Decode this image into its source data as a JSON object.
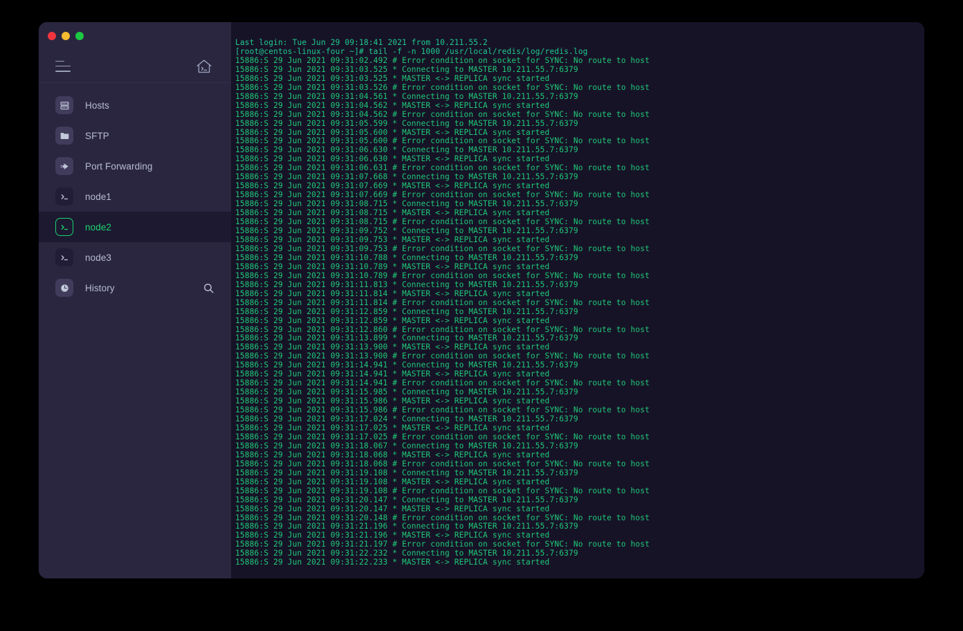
{
  "window": {
    "traffic_lights": [
      {
        "name": "close",
        "color": "#f0353f"
      },
      {
        "name": "minimize",
        "color": "#f6bb2f"
      },
      {
        "name": "maximize",
        "color": "#1dc942"
      }
    ]
  },
  "sidebar": {
    "toolbar": {
      "menu_icon": "hamburger-menu-icon",
      "home_icon": "home-terminal-icon"
    },
    "items": [
      {
        "label": "Hosts",
        "icon": "server-rack-icon",
        "kind": "app",
        "selected": false,
        "trailing": ""
      },
      {
        "label": "SFTP",
        "icon": "folder-icon",
        "kind": "app",
        "selected": false,
        "trailing": ""
      },
      {
        "label": "Port Forwarding",
        "icon": "forward-arrow-icon",
        "kind": "app",
        "selected": false,
        "trailing": ""
      },
      {
        "label": "node1",
        "icon": "terminal-icon",
        "kind": "terminal",
        "selected": false,
        "trailing": ""
      },
      {
        "label": "node2",
        "icon": "terminal-icon",
        "kind": "terminal",
        "selected": true,
        "trailing": ""
      },
      {
        "label": "node3",
        "icon": "terminal-icon",
        "kind": "terminal",
        "selected": false,
        "trailing": ""
      },
      {
        "label": "History",
        "icon": "clock-icon",
        "kind": "app",
        "selected": false,
        "trailing": "search-icon"
      }
    ],
    "colors": {
      "background": "#2a2640",
      "selected_background": "#1d1930",
      "accent_green": "#19d66f",
      "label": "#b9bdd2"
    }
  },
  "terminal": {
    "colors": {
      "background": "#171327",
      "text_green": "#1fc978"
    },
    "lines": [
      "Last login: Tue Jun 29 09:18:41 2021 from 10.211.55.2",
      "[root@centos-linux-four ~]# tail -f -n 1000 /usr/local/redis/log/redis.log",
      "15886:S 29 Jun 2021 09:31:02.492 # Error condition on socket for SYNC: No route to host",
      "15886:S 29 Jun 2021 09:31:03.525 * Connecting to MASTER 10.211.55.7:6379",
      "15886:S 29 Jun 2021 09:31:03.525 * MASTER <-> REPLICA sync started",
      "15886:S 29 Jun 2021 09:31:03.526 # Error condition on socket for SYNC: No route to host",
      "15886:S 29 Jun 2021 09:31:04.561 * Connecting to MASTER 10.211.55.7:6379",
      "15886:S 29 Jun 2021 09:31:04.562 * MASTER <-> REPLICA sync started",
      "15886:S 29 Jun 2021 09:31:04.562 # Error condition on socket for SYNC: No route to host",
      "15886:S 29 Jun 2021 09:31:05.599 * Connecting to MASTER 10.211.55.7:6379",
      "15886:S 29 Jun 2021 09:31:05.600 * MASTER <-> REPLICA sync started",
      "15886:S 29 Jun 2021 09:31:05.600 # Error condition on socket for SYNC: No route to host",
      "15886:S 29 Jun 2021 09:31:06.630 * Connecting to MASTER 10.211.55.7:6379",
      "15886:S 29 Jun 2021 09:31:06.630 * MASTER <-> REPLICA sync started",
      "15886:S 29 Jun 2021 09:31:06.631 # Error condition on socket for SYNC: No route to host",
      "15886:S 29 Jun 2021 09:31:07.668 * Connecting to MASTER 10.211.55.7:6379",
      "15886:S 29 Jun 2021 09:31:07.669 * MASTER <-> REPLICA sync started",
      "15886:S 29 Jun 2021 09:31:07.669 # Error condition on socket for SYNC: No route to host",
      "15886:S 29 Jun 2021 09:31:08.715 * Connecting to MASTER 10.211.55.7:6379",
      "15886:S 29 Jun 2021 09:31:08.715 * MASTER <-> REPLICA sync started",
      "15886:S 29 Jun 2021 09:31:08.715 # Error condition on socket for SYNC: No route to host",
      "15886:S 29 Jun 2021 09:31:09.752 * Connecting to MASTER 10.211.55.7:6379",
      "15886:S 29 Jun 2021 09:31:09.753 * MASTER <-> REPLICA sync started",
      "15886:S 29 Jun 2021 09:31:09.753 # Error condition on socket for SYNC: No route to host",
      "15886:S 29 Jun 2021 09:31:10.788 * Connecting to MASTER 10.211.55.7:6379",
      "15886:S 29 Jun 2021 09:31:10.789 * MASTER <-> REPLICA sync started",
      "15886:S 29 Jun 2021 09:31:10.789 # Error condition on socket for SYNC: No route to host",
      "15886:S 29 Jun 2021 09:31:11.813 * Connecting to MASTER 10.211.55.7:6379",
      "15886:S 29 Jun 2021 09:31:11.814 * MASTER <-> REPLICA sync started",
      "15886:S 29 Jun 2021 09:31:11.814 # Error condition on socket for SYNC: No route to host",
      "15886:S 29 Jun 2021 09:31:12.859 * Connecting to MASTER 10.211.55.7:6379",
      "15886:S 29 Jun 2021 09:31:12.859 * MASTER <-> REPLICA sync started",
      "15886:S 29 Jun 2021 09:31:12.860 # Error condition on socket for SYNC: No route to host",
      "15886:S 29 Jun 2021 09:31:13.899 * Connecting to MASTER 10.211.55.7:6379",
      "15886:S 29 Jun 2021 09:31:13.900 * MASTER <-> REPLICA sync started",
      "15886:S 29 Jun 2021 09:31:13.900 # Error condition on socket for SYNC: No route to host",
      "15886:S 29 Jun 2021 09:31:14.941 * Connecting to MASTER 10.211.55.7:6379",
      "15886:S 29 Jun 2021 09:31:14.941 * MASTER <-> REPLICA sync started",
      "15886:S 29 Jun 2021 09:31:14.941 # Error condition on socket for SYNC: No route to host",
      "15886:S 29 Jun 2021 09:31:15.985 * Connecting to MASTER 10.211.55.7:6379",
      "15886:S 29 Jun 2021 09:31:15.986 * MASTER <-> REPLICA sync started",
      "15886:S 29 Jun 2021 09:31:15.986 # Error condition on socket for SYNC: No route to host",
      "15886:S 29 Jun 2021 09:31:17.024 * Connecting to MASTER 10.211.55.7:6379",
      "15886:S 29 Jun 2021 09:31:17.025 * MASTER <-> REPLICA sync started",
      "15886:S 29 Jun 2021 09:31:17.025 # Error condition on socket for SYNC: No route to host",
      "15886:S 29 Jun 2021 09:31:18.067 * Connecting to MASTER 10.211.55.7:6379",
      "15886:S 29 Jun 2021 09:31:18.068 * MASTER <-> REPLICA sync started",
      "15886:S 29 Jun 2021 09:31:18.068 # Error condition on socket for SYNC: No route to host",
      "15886:S 29 Jun 2021 09:31:19.108 * Connecting to MASTER 10.211.55.7:6379",
      "15886:S 29 Jun 2021 09:31:19.108 * MASTER <-> REPLICA sync started",
      "15886:S 29 Jun 2021 09:31:19.108 # Error condition on socket for SYNC: No route to host",
      "15886:S 29 Jun 2021 09:31:20.147 * Connecting to MASTER 10.211.55.7:6379",
      "15886:S 29 Jun 2021 09:31:20.147 * MASTER <-> REPLICA sync started",
      "15886:S 29 Jun 2021 09:31:20.148 # Error condition on socket for SYNC: No route to host",
      "15886:S 29 Jun 2021 09:31:21.196 * Connecting to MASTER 10.211.55.7:6379",
      "15886:S 29 Jun 2021 09:31:21.196 * MASTER <-> REPLICA sync started",
      "15886:S 29 Jun 2021 09:31:21.197 # Error condition on socket for SYNC: No route to host",
      "15886:S 29 Jun 2021 09:31:22.232 * Connecting to MASTER 10.211.55.7:6379",
      "15886:S 29 Jun 2021 09:31:22.233 * MASTER <-> REPLICA sync started"
    ]
  }
}
